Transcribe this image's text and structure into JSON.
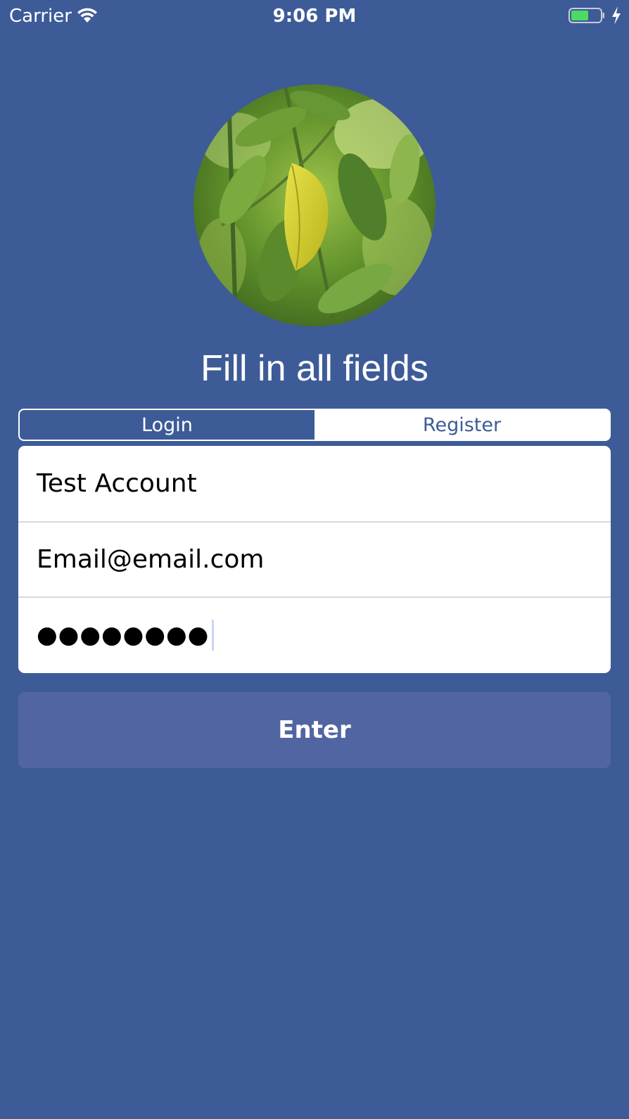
{
  "status_bar": {
    "carrier": "Carrier",
    "time": "9:06 PM",
    "wifi_icon": "wifi-icon",
    "battery_icon": "battery-charging-icon",
    "battery_color": "#4CD964"
  },
  "avatar": {
    "icon": "leaf-photo-avatar"
  },
  "heading": "Fill in all fields",
  "segmented": {
    "login": "Login",
    "register": "Register",
    "selected": "Login"
  },
  "form": {
    "name_value": "Test Account",
    "email_value": "Email@email.com",
    "password_value": "●●●●●●●●"
  },
  "enter_label": "Enter",
  "colors": {
    "background": "#3D5B97",
    "button": "#5265A3",
    "card": "#FFFFFF"
  }
}
